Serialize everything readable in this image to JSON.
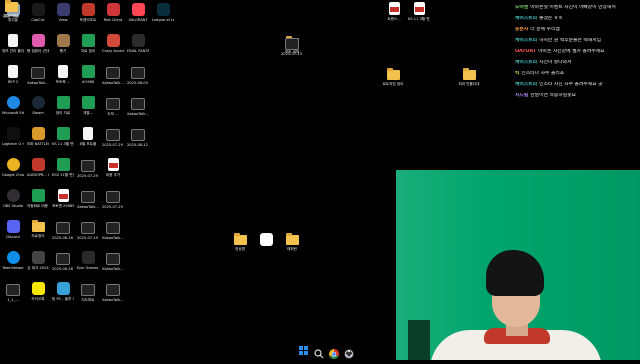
{
  "desktop": {
    "icons": [
      {
        "label": "휴지통",
        "kind": "app",
        "color": "#8fa3b8"
      },
      {
        "label": "CapCut",
        "kind": "app",
        "color": "#1a1a1a"
      },
      {
        "label": "Vrew",
        "kind": "app",
        "color": "#3b3b6d"
      },
      {
        "label": "포켓리조트",
        "kind": "app",
        "color": "#c0392b"
      },
      {
        "label": "Riot Client",
        "kind": "app",
        "color": "#d13639"
      },
      {
        "label": "VALORANT",
        "kind": "app",
        "color": "#ff4655"
      },
      {
        "label": "League of Legends",
        "kind": "app",
        "color": "#0a2e3c"
      },
      {
        "label": "트랜스...",
        "kind": "pdf",
        "color": "#ffffff"
      },
      {
        "label": "KS 11 3월 변호자료",
        "kind": "pdf",
        "color": "#ffffff"
      },
      {
        "label": "정보 관리 폴더",
        "kind": "doc",
        "color": "#e8e8e8"
      },
      {
        "label": "빵 컴퓨터 (전용 화면)",
        "kind": "app",
        "color": "#e05bb0"
      },
      {
        "label": "빵기",
        "kind": "app",
        "color": "#a0784c"
      },
      {
        "label": "자료 정리",
        "kind": "green",
        "color": "#1f9d55"
      },
      {
        "label": "Crazy Arcade",
        "kind": "app",
        "color": "#d24a3a"
      },
      {
        "label": "FINAL FANTASY",
        "kind": "app",
        "color": "#2b2b2b"
      },
      {
        "label": "포토 세체",
        "kind": "folder",
        "color": "#f2c14e"
      },
      {
        "label": "KakaoTalk...",
        "kind": "video",
        "color": "#222222"
      },
      {
        "label": "REP 2",
        "kind": "doc",
        "color": "#e8e8e8"
      },
      {
        "label": "포토북 ...",
        "kind": "doc",
        "color": "#e8e8e8"
      },
      {
        "label": "#1988",
        "kind": "green",
        "color": "#1f9d55"
      },
      {
        "label": "KakaoTalk...",
        "kind": "video",
        "color": "#222222"
      },
      {
        "label": "2025-06-05 23-16-12",
        "kind": "video",
        "color": "#222222"
      },
      {
        "label": "Microsoft Edge",
        "kind": "round",
        "color": "#1e88e5"
      },
      {
        "label": "Steam",
        "kind": "round",
        "color": "#1b2838"
      },
      {
        "label": "정리 자료",
        "kind": "green",
        "color": "#1f9d55"
      },
      {
        "label": "개별...",
        "kind": "green",
        "color": "#1f9d55"
      },
      {
        "label": "도보 ...",
        "kind": "video",
        "color": "#222222"
      },
      {
        "label": "KakaoTalk...",
        "kind": "video",
        "color": "#222222"
      },
      {
        "label": "Logitech G HUB",
        "kind": "app",
        "color": "#101010"
      },
      {
        "label": "리퍼 BATTLEGR...",
        "kind": "app",
        "color": "#d99a2b"
      },
      {
        "label": "KS 11 3월 변호자료",
        "kind": "green",
        "color": "#1f9d55"
      },
      {
        "label": "8월 포트폴",
        "kind": "doc",
        "color": "#e8e8e8"
      },
      {
        "label": "2025-07-29 07-17-25",
        "kind": "video",
        "color": "#222222"
      },
      {
        "label": "2025-08-12 20-01-29",
        "kind": "video",
        "color": "#222222"
      },
      {
        "label": "Google Chrome",
        "kind": "round",
        "color": "#e9b321"
      },
      {
        "label": "AUDIOPR... CIE Control",
        "kind": "app",
        "color": "#c0392b"
      },
      {
        "label": "KSV 11월 변호자료",
        "kind": "green",
        "color": "#1f9d55"
      },
      {
        "label": "2025-07-29 21-02-24",
        "kind": "video",
        "color": "#222222"
      },
      {
        "label": "비용 추가",
        "kind": "pdf",
        "color": "#ffffff"
      },
      {
        "label": "OBS Studio",
        "kind": "round",
        "color": "#302e31"
      },
      {
        "label": "자동화로 비용 거기",
        "kind": "green",
        "color": "#1f9d55"
      },
      {
        "label": "포토앤 290891_11",
        "kind": "pdf",
        "color": "#ffffff"
      },
      {
        "label": "KakaoTalk...",
        "kind": "video",
        "color": "#222222"
      },
      {
        "label": "2025-07-29 03-28-12",
        "kind": "video",
        "color": "#222222"
      },
      {
        "label": "Discord",
        "kind": "app",
        "color": "#5865f2"
      },
      {
        "label": "자료정리",
        "kind": "folder",
        "color": "#f2c14e"
      },
      {
        "label": "2025-06-16 18-13-38",
        "kind": "video",
        "color": "#222222"
      },
      {
        "label": "2025-07-19 22-51-51",
        "kind": "video",
        "color": "#222222"
      },
      {
        "label": "KakaoTalk...",
        "kind": "video",
        "color": "#222222"
      },
      {
        "label": "TeamViewer",
        "kind": "round",
        "color": "#0e8ee9"
      },
      {
        "label": "돈 위크 2024",
        "kind": "app",
        "color": "#444444"
      },
      {
        "label": "2025-06-16 18-13-38",
        "kind": "video",
        "color": "#222222"
      },
      {
        "label": "Epic Games Launcher",
        "kind": "app",
        "color": "#2a2a2a"
      },
      {
        "label": "KakaoTalk...",
        "kind": "video",
        "color": "#222222"
      },
      {
        "label": "1_1_...",
        "kind": "video",
        "color": "#222222"
      },
      {
        "label": "카카오톡",
        "kind": "app",
        "color": "#f7e600"
      },
      {
        "label": "팀 PC - 블루 거기",
        "kind": "app",
        "color": "#3aa0d8"
      },
      {
        "label": "지도파트",
        "kind": "video",
        "color": "#222222"
      },
      {
        "label": "KakaoTalk...",
        "kind": "video",
        "color": "#222222"
      },
      {
        "label": "2025-07-13 22-20-08",
        "kind": "video",
        "color": "#222222"
      },
      {
        "label": "1_1_...",
        "kind": "video",
        "color": "#222222"
      },
      {
        "label": "로트작업 정리",
        "kind": "folder",
        "color": "#f2c14e"
      },
      {
        "label": "최리 빈폴더대",
        "kind": "folder",
        "color": "#f2c14e"
      },
      {
        "label": "영상편",
        "kind": "folder",
        "color": "#f2c14e"
      },
      {
        "label": "",
        "kind": "app",
        "color": "#ffffff"
      },
      {
        "label": "레퍼런",
        "kind": "folder",
        "color": "#f2c14e"
      },
      {
        "label": "유튜브영상",
        "kind": "folder",
        "color": "#c79a3a"
      },
      {
        "label": "예상 자료",
        "kind": "folder",
        "color": "#f2c14e"
      }
    ]
  },
  "chat": {
    "messages": [
      {
        "name": "도어멘",
        "text": "아마존넷 이벤트 사진이 아빠같이 만장해서",
        "color": "#7ddc6e"
      },
      {
        "name": "케이스트리",
        "text": "좋겠는 ㅎㅎ",
        "color": "#4bd0d0"
      },
      {
        "name": "충분자",
        "text": "더 운에 우리멤",
        "color": "#ff9b4a"
      },
      {
        "name": "케이스트리",
        "text": "하지만 뭔 맥후분들은 렉해서임",
        "color": "#4bd0d0"
      },
      {
        "name": "OATOAT",
        "text": "아마존 사신같에 셀카 올려주세요",
        "color": "#ff5a5a"
      },
      {
        "name": "케이스트리",
        "text": "사진이 잘나와서",
        "color": "#4bd0d0"
      },
      {
        "name": "킥",
        "text": "인스타나 자주 올리죠",
        "color": "#d8e04a"
      },
      {
        "name": "케이스트리",
        "text": "인스타 사진 자주 올려주세요 곳",
        "color": "#4bd0d0"
      },
      {
        "name": "지드림",
        "text": "한달이면 적응하실듯요",
        "color": "#b48bff"
      }
    ]
  },
  "taskbar": {
    "items": [
      {
        "name": "start-button-icon"
      },
      {
        "name": "search-icon"
      },
      {
        "name": "chrome-taskbar-icon"
      },
      {
        "name": "obs-taskbar-icon"
      }
    ]
  },
  "webcam": {
    "background_color": "#00a46c"
  }
}
